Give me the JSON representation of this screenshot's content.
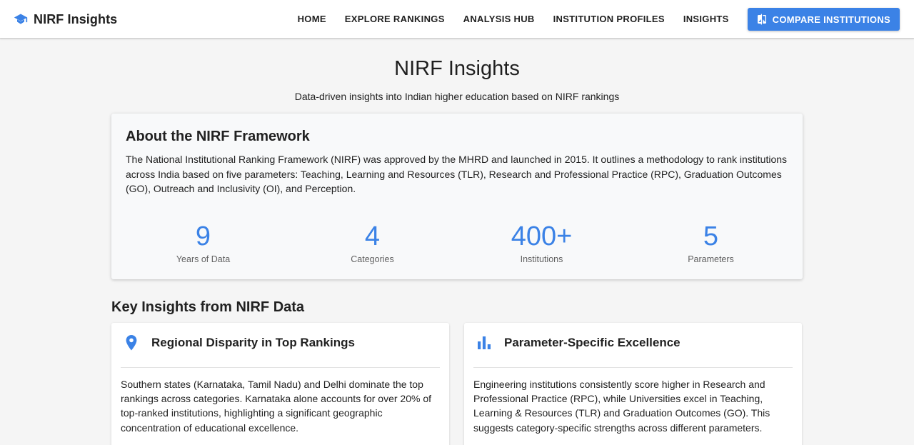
{
  "header": {
    "brand": "NIRF Insights",
    "brand_icon": "graduation-cap-icon",
    "nav": [
      "HOME",
      "EXPLORE RANKINGS",
      "ANALYSIS HUB",
      "INSTITUTION PROFILES",
      "INSIGHTS"
    ],
    "compare_button": "COMPARE INSTITUTIONS",
    "compare_icon": "compare-icon"
  },
  "hero": {
    "title": "NIRF Insights",
    "subtitle": "Data-driven insights into Indian higher education based on NIRF rankings"
  },
  "about": {
    "title": "About the NIRF Framework",
    "text": "The National Institutional Ranking Framework (NIRF) was approved by the MHRD and launched in 2015. It outlines a methodology to rank institutions across India based on five parameters: Teaching, Learning and Resources (TLR), Research and Professional Practice (RPC), Graduation Outcomes (GO), Outreach and Inclusivity (OI), and Perception.",
    "stats": [
      {
        "value": "9",
        "label": "Years of Data"
      },
      {
        "value": "4",
        "label": "Categories"
      },
      {
        "value": "400+",
        "label": "Institutions"
      },
      {
        "value": "5",
        "label": "Parameters"
      }
    ]
  },
  "insights": {
    "section_title": "Key Insights from NIRF Data",
    "cards": [
      {
        "icon": "location-pin-icon",
        "title": "Regional Disparity in Top Rankings",
        "text": "Southern states (Karnataka, Tamil Nadu) and Delhi dominate the top rankings across categories. Karnataka alone accounts for over 20% of top-ranked institutions, highlighting a significant geographic concentration of educational excellence."
      },
      {
        "icon": "bar-chart-icon",
        "title": "Parameter-Specific Excellence",
        "text": "Engineering institutions consistently score higher in Research and Professional Practice (RPC), while Universities excel in Teaching, Learning & Resources (TLR) and Graduation Outcomes (GO). This suggests category-specific strengths across different parameters."
      }
    ]
  },
  "colors": {
    "accent": "#3b82e6",
    "background": "#f5f5f5",
    "card": "#ffffff"
  }
}
